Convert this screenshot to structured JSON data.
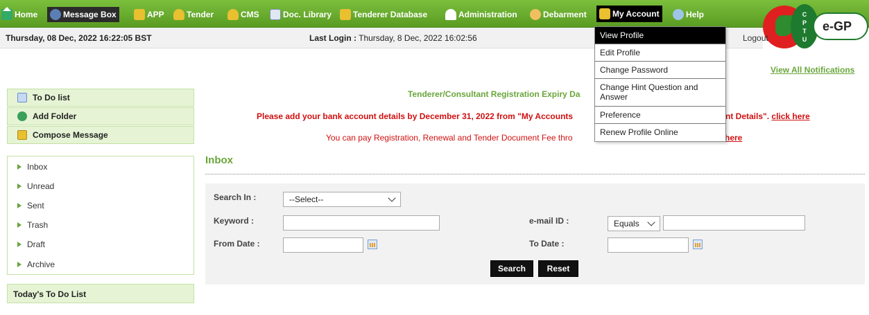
{
  "nav": {
    "items": [
      {
        "label": "Home",
        "icon": "home-icon"
      },
      {
        "label": "Message Box",
        "icon": "message-icon"
      },
      {
        "label": "APP",
        "icon": "app-icon"
      },
      {
        "label": "Tender",
        "icon": "tender-icon"
      },
      {
        "label": "CMS",
        "icon": "cms-icon"
      },
      {
        "label": "Doc. Library",
        "icon": "document-icon"
      },
      {
        "label": "Tenderer Database",
        "icon": "database-icon"
      },
      {
        "label": "Administration",
        "icon": "admin-icon"
      },
      {
        "label": "Debarment",
        "icon": "debarment-icon"
      },
      {
        "label": "My Account",
        "icon": "account-icon"
      },
      {
        "label": "Help",
        "icon": "help-icon"
      }
    ],
    "active": "My Account",
    "accent": "#6aa63b"
  },
  "logo": {
    "cptu": "C P T U",
    "egp": "e-GP"
  },
  "status": {
    "datetime": "Thursday, 08 Dec, 2022 16:22:05 BST",
    "last_login_label": "Last Login :",
    "last_login_value": " Thursday, 8 Dec, 2022 16:02:56",
    "logout": "Logout"
  },
  "account_menu": [
    "View Profile",
    "Edit Profile",
    "Change Password",
    "Change Hint Question and Answer",
    "Preference",
    "Renew Profile Online"
  ],
  "notifications": {
    "view_all": "View All Notifications"
  },
  "notices": {
    "registration_expiry": "Tenderer/Consultant Registration Expiry Da",
    "bank_text": "Please add your bank account details by December 31, 2022 from \"My Accounts",
    "bank_text_end": "nt Details\".",
    "bank_link": "click here",
    "payment_text": "You can pay Registration, Renewal and Tender Document Fee thro",
    "payment_link": "here"
  },
  "left_panel": {
    "todo_list": "To Do list",
    "add_folder": "Add Folder",
    "compose": "Compose Message",
    "folders": [
      "Inbox",
      "Unread",
      "Sent",
      "Trash",
      "Draft",
      "Archive"
    ],
    "today_todo": "Today's To Do List"
  },
  "inbox": {
    "title": "Inbox",
    "search_in_label": "Search In :",
    "search_in_value": "--Select--",
    "keyword_label": "Keyword :",
    "email_label": "e-mail ID :",
    "email_match": "Equals",
    "from_date_label": "From Date :",
    "to_date_label": "To Date :",
    "search_button": "Search",
    "reset_button": "Reset"
  }
}
